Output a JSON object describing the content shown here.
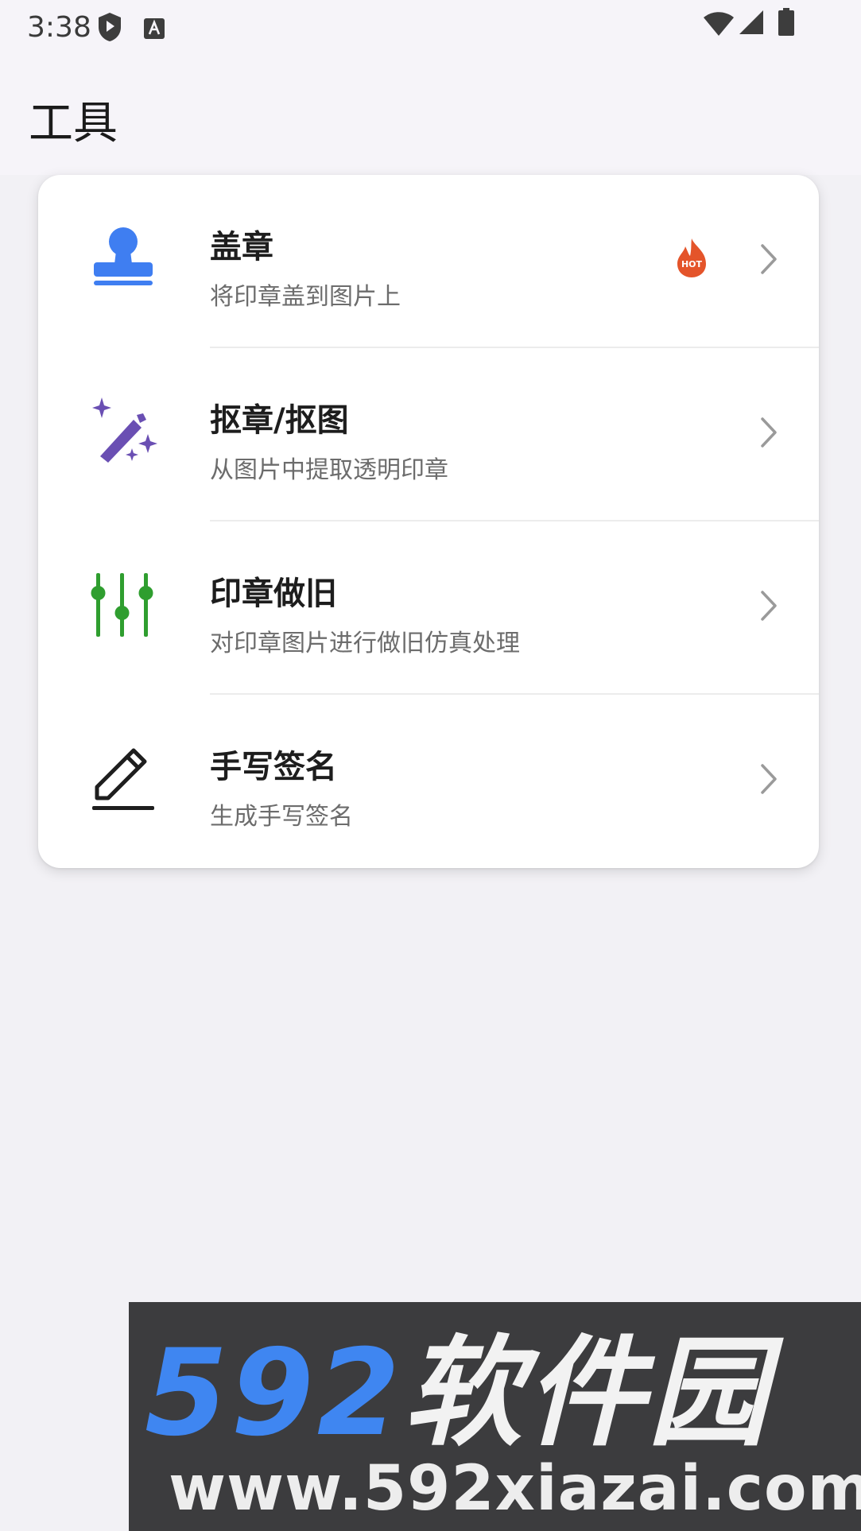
{
  "status_bar": {
    "time": "3:38",
    "icons": [
      "shield-play-icon",
      "keyboard-a-icon",
      "wifi-icon",
      "signal-icon",
      "battery-icon"
    ]
  },
  "header": {
    "title": "工具"
  },
  "tools": [
    {
      "title": "盖章",
      "subtitle": "将印章盖到图片上",
      "icon": "stamp-icon",
      "icon_color": "#3f7ef1",
      "badge": "HOT"
    },
    {
      "title": "抠章/抠图",
      "subtitle": "从图片中提取透明印章",
      "icon": "magic-wand-icon",
      "icon_color": "#6a4fb3"
    },
    {
      "title": "印章做旧",
      "subtitle": "对印章图片进行做旧仿真处理",
      "icon": "sliders-icon",
      "icon_color": "#2f9e2f"
    },
    {
      "title": "手写签名",
      "subtitle": "生成手写签名",
      "icon": "pencil-icon",
      "icon_color": "#1e1e1e"
    }
  ],
  "watermark": {
    "brand_num": "592",
    "brand_cn": "软件园",
    "url": "www.592xiazai.com"
  },
  "colors": {
    "hot_badge": "#e4542a",
    "chevron": "#9a9a9a"
  }
}
